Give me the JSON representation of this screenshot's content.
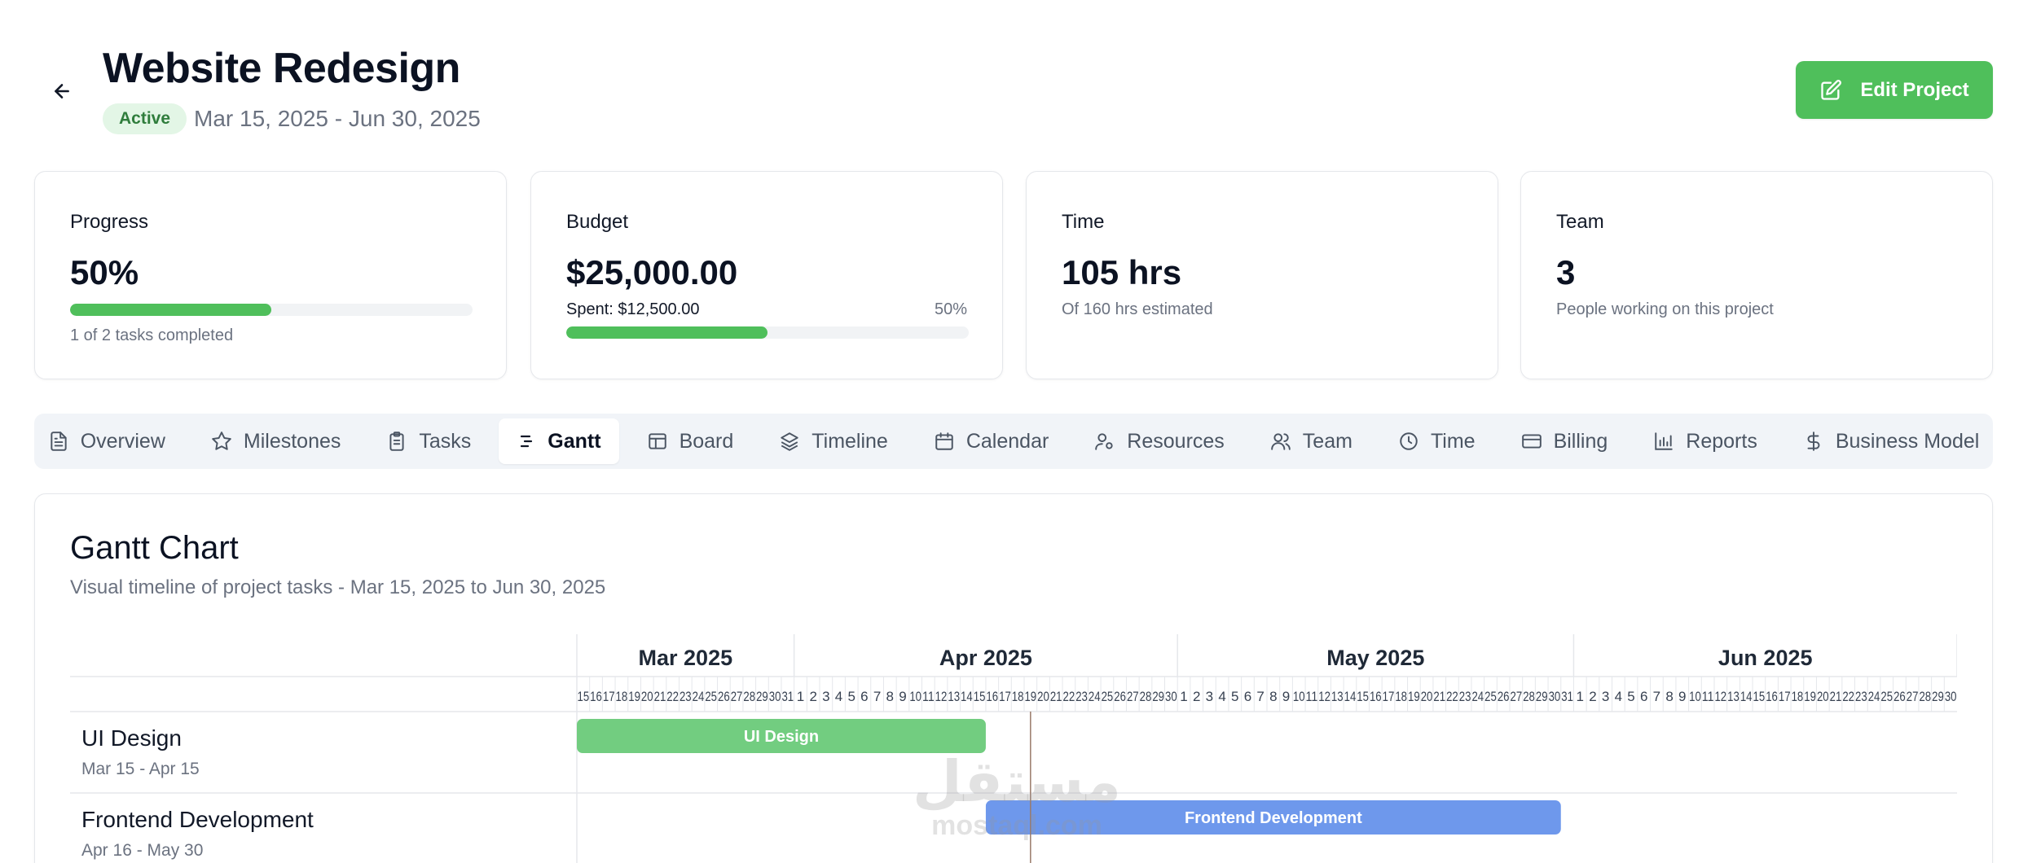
{
  "header": {
    "title": "Website Redesign",
    "status": "Active",
    "date_range": "Mar 15, 2025 - Jun 30, 2025",
    "edit_label": "Edit Project"
  },
  "stats": {
    "progress": {
      "label": "Progress",
      "value": "50%",
      "fraction": 0.5,
      "sub": "1 of 2 tasks completed"
    },
    "budget": {
      "label": "Budget",
      "value": "$25,000.00",
      "spent": "Spent: $12,500.00",
      "percent": "50%",
      "fraction": 0.5
    },
    "time": {
      "label": "Time",
      "value": "105 hrs",
      "sub": "Of 160 hrs estimated"
    },
    "team": {
      "label": "Team",
      "value": "3",
      "sub": "People working on this project"
    }
  },
  "tabs": [
    {
      "label": "Overview",
      "icon": "file-text-icon"
    },
    {
      "label": "Milestones",
      "icon": "star-icon"
    },
    {
      "label": "Tasks",
      "icon": "clipboard-icon"
    },
    {
      "label": "Gantt",
      "icon": "gantt-icon",
      "active": true
    },
    {
      "label": "Board",
      "icon": "board-icon"
    },
    {
      "label": "Timeline",
      "icon": "layers-icon"
    },
    {
      "label": "Calendar",
      "icon": "calendar-icon"
    },
    {
      "label": "Resources",
      "icon": "resources-icon"
    },
    {
      "label": "Team",
      "icon": "users-icon"
    },
    {
      "label": "Time",
      "icon": "clock-icon"
    },
    {
      "label": "Billing",
      "icon": "credit-card-icon"
    },
    {
      "label": "Reports",
      "icon": "bar-chart-icon"
    },
    {
      "label": "Business Model",
      "icon": "dollar-icon"
    }
  ],
  "gantt": {
    "title": "Gantt Chart",
    "subtitle": "Visual timeline of project tasks - Mar 15, 2025 to Jun 30, 2025",
    "start_date": "2025-03-15",
    "end_date": "2025-06-30",
    "today": "2025-04-19",
    "months": [
      {
        "label": "Mar 2025",
        "start": "2025-03-15",
        "end": "2025-03-31"
      },
      {
        "label": "Apr 2025",
        "start": "2025-04-01",
        "end": "2025-04-30"
      },
      {
        "label": "May 2025",
        "start": "2025-05-01",
        "end": "2025-05-31"
      },
      {
        "label": "Jun 2025",
        "start": "2025-06-01",
        "end": "2025-06-30"
      }
    ],
    "tasks": [
      {
        "name": "UI Design",
        "dates": "Mar 15 - Apr 15",
        "start": "2025-03-15",
        "end": "2025-04-15",
        "color": "#72cd80",
        "bar_label": "UI Design"
      },
      {
        "name": "Frontend Development",
        "dates": "Apr 16 - May 30",
        "start": "2025-04-16",
        "end": "2025-05-30",
        "color": "#6e98ec",
        "bar_label": "Frontend Development"
      }
    ]
  },
  "watermark": {
    "arabic": "مستقل",
    "latin": "mostaql.com"
  },
  "colors": {
    "accent": "#4fbf5b",
    "active_badge_bg": "#e3f6e6",
    "active_badge_text": "#2f7d3c"
  }
}
